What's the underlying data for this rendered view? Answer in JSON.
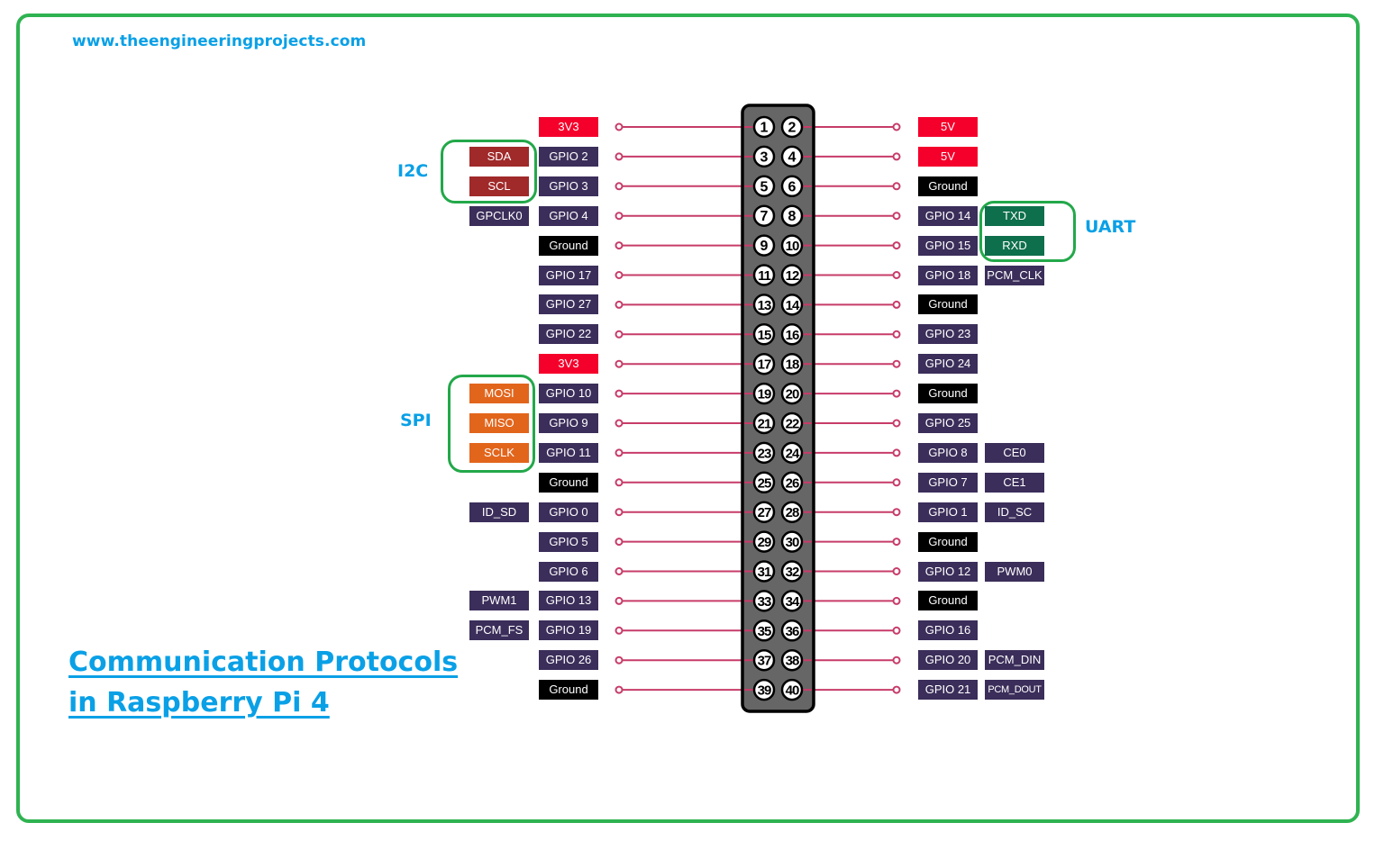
{
  "website": "www.theengineeringprojects.com",
  "title_lines": [
    "Communication Protocols",
    "in Raspberry Pi 4"
  ],
  "colors": {
    "frame": "#2fb351",
    "accent_text": "#0aa0e6",
    "power": "#f5002b",
    "ground": "#000000",
    "gpio": "#3b2e5a",
    "i2c": "#a0292a",
    "spi": "#e2651c",
    "uart": "#0e6f4c",
    "wire": "#c73c69",
    "header_fill": "#666666"
  },
  "protocol_groups": [
    {
      "name": "I2C",
      "side": "left",
      "signals": [
        "SDA",
        "SCL"
      ]
    },
    {
      "name": "SPI",
      "side": "left",
      "signals": [
        "MOSI",
        "MISO",
        "SCLK"
      ]
    },
    {
      "name": "UART",
      "side": "right",
      "signals": [
        "TXD",
        "RXD"
      ]
    }
  ],
  "rows": [
    {
      "left": {
        "pin": 1,
        "label": "3V3",
        "type": "power",
        "alt": null,
        "alt_type": null
      },
      "right": {
        "pin": 2,
        "label": "5V",
        "type": "power",
        "alt": null,
        "alt_type": null
      }
    },
    {
      "left": {
        "pin": 3,
        "label": "GPIO 2",
        "type": "gpio",
        "alt": "SDA",
        "alt_type": "i2c"
      },
      "right": {
        "pin": 4,
        "label": "5V",
        "type": "power",
        "alt": null,
        "alt_type": null
      }
    },
    {
      "left": {
        "pin": 5,
        "label": "GPIO 3",
        "type": "gpio",
        "alt": "SCL",
        "alt_type": "i2c"
      },
      "right": {
        "pin": 6,
        "label": "Ground",
        "type": "ground",
        "alt": null,
        "alt_type": null
      }
    },
    {
      "left": {
        "pin": 7,
        "label": "GPIO 4",
        "type": "gpio",
        "alt": "GPCLK0",
        "alt_type": "gpio"
      },
      "right": {
        "pin": 8,
        "label": "GPIO 14",
        "type": "gpio",
        "alt": "TXD",
        "alt_type": "uart"
      }
    },
    {
      "left": {
        "pin": 9,
        "label": "Ground",
        "type": "ground",
        "alt": null,
        "alt_type": null
      },
      "right": {
        "pin": 10,
        "label": "GPIO 15",
        "type": "gpio",
        "alt": "RXD",
        "alt_type": "uart"
      }
    },
    {
      "left": {
        "pin": 11,
        "label": "GPIO 17",
        "type": "gpio",
        "alt": null,
        "alt_type": null
      },
      "right": {
        "pin": 12,
        "label": "GPIO 18",
        "type": "gpio",
        "alt": "PCM_CLK",
        "alt_type": "gpio"
      }
    },
    {
      "left": {
        "pin": 13,
        "label": "GPIO 27",
        "type": "gpio",
        "alt": null,
        "alt_type": null
      },
      "right": {
        "pin": 14,
        "label": "Ground",
        "type": "ground",
        "alt": null,
        "alt_type": null
      }
    },
    {
      "left": {
        "pin": 15,
        "label": "GPIO 22",
        "type": "gpio",
        "alt": null,
        "alt_type": null
      },
      "right": {
        "pin": 16,
        "label": "GPIO 23",
        "type": "gpio",
        "alt": null,
        "alt_type": null
      }
    },
    {
      "left": {
        "pin": 17,
        "label": "3V3",
        "type": "power",
        "alt": null,
        "alt_type": null
      },
      "right": {
        "pin": 18,
        "label": "GPIO 24",
        "type": "gpio",
        "alt": null,
        "alt_type": null
      }
    },
    {
      "left": {
        "pin": 19,
        "label": "GPIO 10",
        "type": "gpio",
        "alt": "MOSI",
        "alt_type": "spi"
      },
      "right": {
        "pin": 20,
        "label": "Ground",
        "type": "ground",
        "alt": null,
        "alt_type": null
      }
    },
    {
      "left": {
        "pin": 21,
        "label": "GPIO 9",
        "type": "gpio",
        "alt": "MISO",
        "alt_type": "spi"
      },
      "right": {
        "pin": 22,
        "label": "GPIO 25",
        "type": "gpio",
        "alt": null,
        "alt_type": null
      }
    },
    {
      "left": {
        "pin": 23,
        "label": "GPIO 11",
        "type": "gpio",
        "alt": "SCLK",
        "alt_type": "spi"
      },
      "right": {
        "pin": 24,
        "label": "GPIO 8",
        "type": "gpio",
        "alt": "CE0",
        "alt_type": "gpio"
      }
    },
    {
      "left": {
        "pin": 25,
        "label": "Ground",
        "type": "ground",
        "alt": null,
        "alt_type": null
      },
      "right": {
        "pin": 26,
        "label": "GPIO 7",
        "type": "gpio",
        "alt": "CE1",
        "alt_type": "gpio"
      }
    },
    {
      "left": {
        "pin": 27,
        "label": "GPIO 0",
        "type": "gpio",
        "alt": "ID_SD",
        "alt_type": "gpio"
      },
      "right": {
        "pin": 28,
        "label": "GPIO 1",
        "type": "gpio",
        "alt": "ID_SC",
        "alt_type": "gpio"
      }
    },
    {
      "left": {
        "pin": 29,
        "label": "GPIO 5",
        "type": "gpio",
        "alt": null,
        "alt_type": null
      },
      "right": {
        "pin": 30,
        "label": "Ground",
        "type": "ground",
        "alt": null,
        "alt_type": null
      }
    },
    {
      "left": {
        "pin": 31,
        "label": "GPIO 6",
        "type": "gpio",
        "alt": null,
        "alt_type": null
      },
      "right": {
        "pin": 32,
        "label": "GPIO 12",
        "type": "gpio",
        "alt": "PWM0",
        "alt_type": "gpio"
      }
    },
    {
      "left": {
        "pin": 33,
        "label": "GPIO 13",
        "type": "gpio",
        "alt": "PWM1",
        "alt_type": "gpio"
      },
      "right": {
        "pin": 34,
        "label": "Ground",
        "type": "ground",
        "alt": null,
        "alt_type": null
      }
    },
    {
      "left": {
        "pin": 35,
        "label": "GPIO 19",
        "type": "gpio",
        "alt": "PCM_FS",
        "alt_type": "gpio"
      },
      "right": {
        "pin": 36,
        "label": "GPIO 16",
        "type": "gpio",
        "alt": null,
        "alt_type": null
      }
    },
    {
      "left": {
        "pin": 37,
        "label": "GPIO 26",
        "type": "gpio",
        "alt": null,
        "alt_type": null
      },
      "right": {
        "pin": 38,
        "label": "GPIO 20",
        "type": "gpio",
        "alt": "PCM_DIN",
        "alt_type": "gpio"
      }
    },
    {
      "left": {
        "pin": 39,
        "label": "Ground",
        "type": "ground",
        "alt": null,
        "alt_type": null
      },
      "right": {
        "pin": 40,
        "label": "GPIO 21",
        "type": "gpio",
        "alt": "PCM_DOUT",
        "alt_type": "gpio"
      }
    }
  ]
}
